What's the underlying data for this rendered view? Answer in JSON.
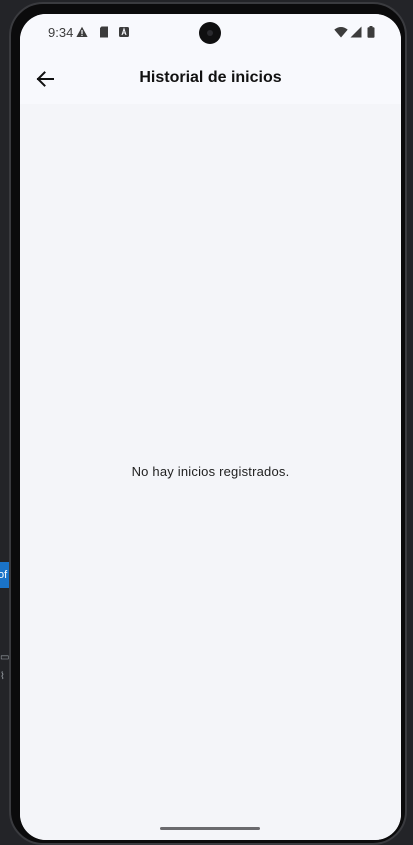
{
  "status_bar": {
    "time": "9:34",
    "icons_left": [
      "warning-icon",
      "sd-card-icon",
      "a-badge-icon"
    ],
    "icons_right": [
      "wifi-icon",
      "cell-signal-icon",
      "battery-icon"
    ]
  },
  "app_bar": {
    "back_icon": "arrow-left-icon",
    "title": "Historial de inicios"
  },
  "content": {
    "empty_message": "No hay inicios registrados."
  },
  "colors": {
    "background": "#f4f5f9",
    "app_bar": "#f8f9fd",
    "text": "#111111",
    "side_tab": "#1a73c8"
  }
}
